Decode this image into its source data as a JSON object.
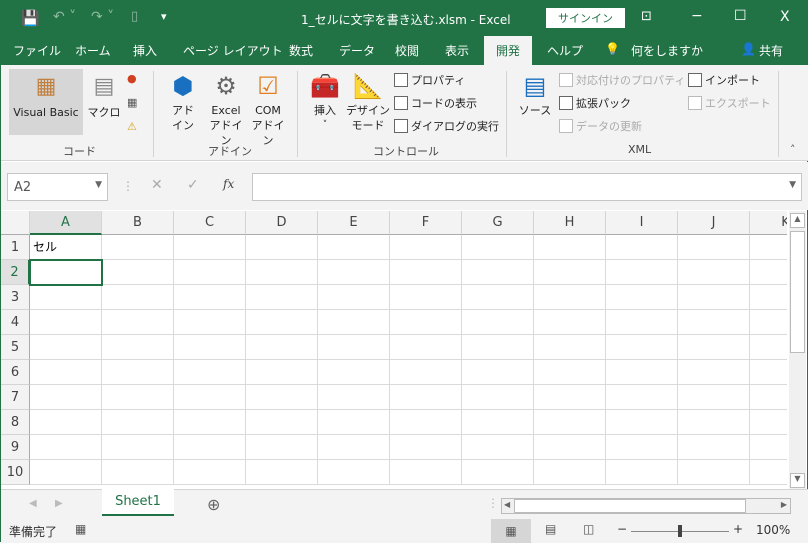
{
  "title_bar": {
    "document_title": "1_セルに文字を書き込む.xlsm  -  Excel",
    "signin": "サインイン",
    "minimize": "−",
    "maximize": "☐",
    "close": "X",
    "ribbon_display": "⊡"
  },
  "tabs": [
    "ファイル",
    "ホーム",
    "挿入",
    "ページ レイアウト",
    "数式",
    "データ",
    "校閲",
    "表示",
    "開発",
    "ヘルプ"
  ],
  "active_tab": "開発",
  "tell_me": "何をしますか",
  "share": "共有",
  "ribbon": {
    "code": {
      "label": "コード",
      "visual_basic": "Visual Basic",
      "macro": "マクロ"
    },
    "addins": {
      "label": "アドイン",
      "addin1": "アド",
      "addin2": "イン",
      "excel1": "Excel",
      "excel2": "アドイン",
      "com1": "COM",
      "com2": "アドイン"
    },
    "controls": {
      "label": "コントロール",
      "insert": "挿入",
      "design1": "デザイン",
      "design2": "モード",
      "properties": "プロパティ",
      "view_code": "コードの表示",
      "run_dialog": "ダイアログの実行"
    },
    "xml": {
      "label": "XML",
      "source": "ソース",
      "map_properties": "対応付けのプロパティ",
      "expansion_packs": "拡張パック",
      "refresh_data": "データの更新",
      "import": "インポート",
      "export": "エクスポート"
    }
  },
  "formula_bar": {
    "name_box": "A2",
    "fx": "fx",
    "cancel": "✕",
    "enter": "✓",
    "value": ""
  },
  "columns": [
    "A",
    "B",
    "C",
    "D",
    "E",
    "F",
    "G",
    "H",
    "I",
    "J",
    "K"
  ],
  "rows": [
    "1",
    "2",
    "3",
    "4",
    "5",
    "6",
    "7",
    "8",
    "9",
    "10"
  ],
  "cells": {
    "A1": "セル"
  },
  "selected_cell": "A2",
  "sheets": [
    "Sheet1"
  ],
  "status": {
    "ready": "準備完了",
    "zoom": "100%",
    "zoom_minus": "−",
    "zoom_plus": "+"
  },
  "colors": {
    "accent": "#217346"
  }
}
